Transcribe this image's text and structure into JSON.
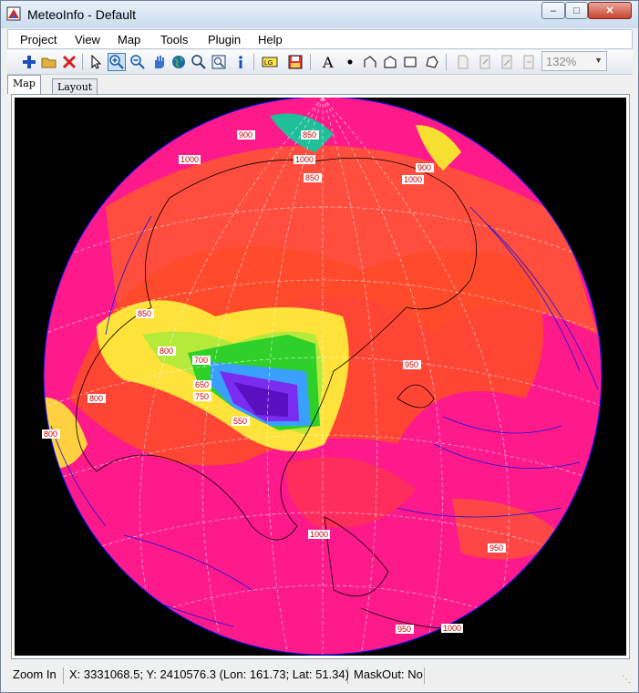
{
  "window": {
    "title": "MeteoInfo - Default",
    "minimize": "–",
    "maximize": "□",
    "close": "✕"
  },
  "menu": {
    "items": [
      "Project",
      "View",
      "Map",
      "Tools",
      "Plugin",
      "Help"
    ]
  },
  "toolbar": {
    "zoom_level": "132%",
    "buttons": [
      "add-layer-icon",
      "open-folder-icon",
      "remove-layer-icon",
      "select-arrow-icon",
      "zoom-in-icon",
      "zoom-out-icon",
      "pan-hand-icon",
      "globe-icon",
      "magnifier-icon",
      "zoom-full-extent-icon",
      "info-icon",
      "legend-icon",
      "save-image-icon",
      "text-icon",
      "point-icon",
      "polyline-icon",
      "polygon-icon",
      "rectangle-icon",
      "curve-polygon-icon",
      "page-icon",
      "page-zoom-icon",
      "page-fit-icon",
      "page-export-icon"
    ]
  },
  "tabs": [
    "Map",
    "Layout"
  ],
  "map": {
    "contour_labels": [
      "900",
      "850",
      "1000",
      "1000",
      "900",
      "1000",
      "850",
      "800",
      "800",
      "700",
      "650",
      "750",
      "550",
      "950",
      "1000",
      "950",
      "950",
      "1000",
      "800",
      "850"
    ]
  },
  "status": {
    "tool": "Zoom In",
    "coords": "X: 3331068.5; Y: 2410576.3 (Lon: 161.73; Lat: 51.34)",
    "mask": "MaskOut: No"
  }
}
